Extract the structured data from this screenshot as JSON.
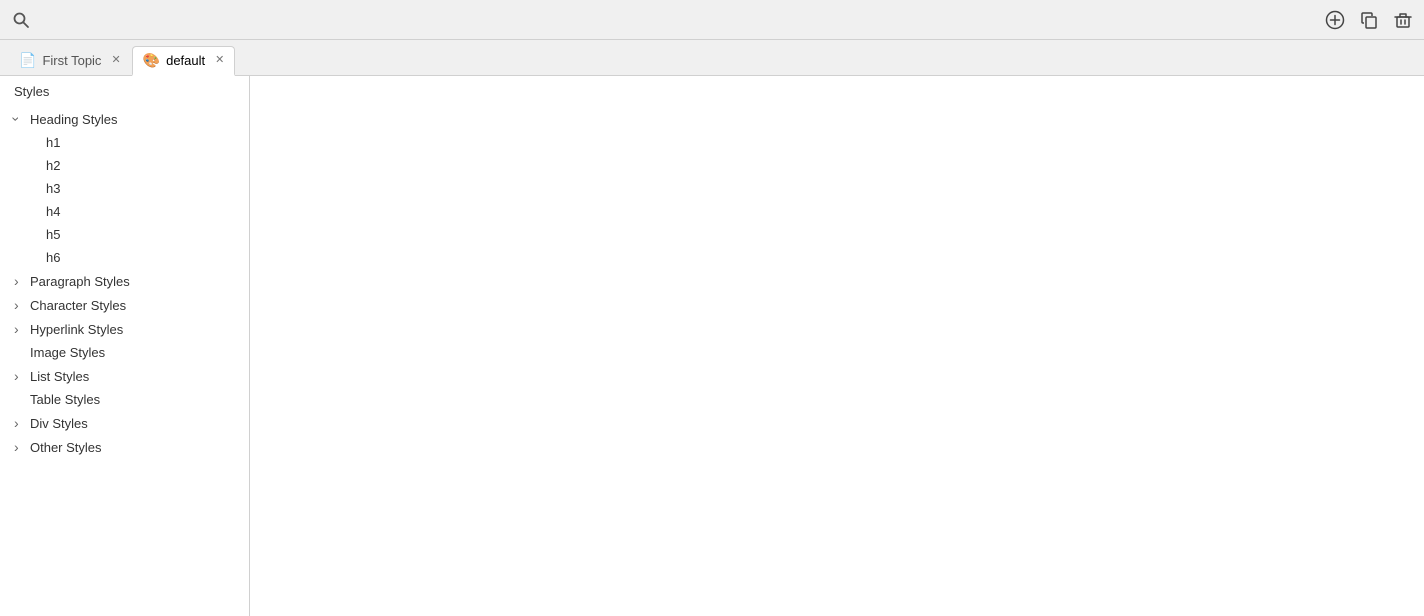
{
  "toolbar": {
    "search_icon": "search-icon",
    "add_icon": "add-icon",
    "copy_icon": "copy-icon",
    "delete_icon": "delete-icon"
  },
  "tabs": [
    {
      "id": "first-topic",
      "label": "First Topic",
      "icon": "📄",
      "closable": true,
      "active": false
    },
    {
      "id": "default",
      "label": "default",
      "icon": "🎨",
      "closable": true,
      "active": true
    }
  ],
  "sidebar": {
    "header": "Styles",
    "items": [
      {
        "id": "heading-styles",
        "label": "Heading Styles",
        "expandable": true,
        "expanded": true,
        "children": [
          "h1",
          "h2",
          "h3",
          "h4",
          "h5",
          "h6"
        ]
      },
      {
        "id": "paragraph-styles",
        "label": "Paragraph Styles",
        "expandable": true,
        "expanded": false,
        "children": []
      },
      {
        "id": "character-styles",
        "label": "Character Styles",
        "expandable": true,
        "expanded": false,
        "children": []
      },
      {
        "id": "hyperlink-styles",
        "label": "Hyperlink Styles",
        "expandable": true,
        "expanded": false,
        "children": []
      },
      {
        "id": "image-styles",
        "label": "Image Styles",
        "expandable": false,
        "expanded": false,
        "children": []
      },
      {
        "id": "list-styles",
        "label": "List Styles",
        "expandable": true,
        "expanded": false,
        "children": []
      },
      {
        "id": "table-styles",
        "label": "Table Styles",
        "expandable": false,
        "expanded": false,
        "children": []
      },
      {
        "id": "div-styles",
        "label": "Div Styles",
        "expandable": true,
        "expanded": false,
        "children": []
      },
      {
        "id": "other-styles",
        "label": "Other Styles",
        "expandable": true,
        "expanded": false,
        "children": []
      }
    ]
  }
}
